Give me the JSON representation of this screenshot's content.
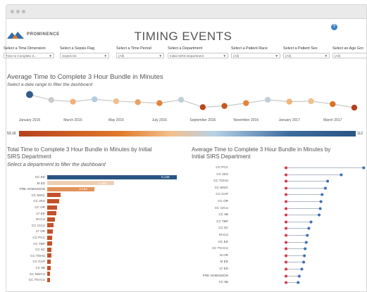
{
  "app": {
    "brand": "PROMINENCE",
    "title": "TIMING EVENTS"
  },
  "colors": {
    "accent_blue": "#2a5585",
    "accent_orange": "#b5411b",
    "help_blue": "#3d7fc6",
    "lollipop_red": "#d6374a"
  },
  "filters": [
    {
      "label": "Select a Time Dimension",
      "value": "Time to Complete 3..."
    },
    {
      "label": "Select a Sepsis Flag",
      "value": "Sepsis Dx"
    },
    {
      "label": "Select a Time Period",
      "value": "(All)"
    },
    {
      "label": "Select a Department",
      "value": "Initial SIRS Department"
    },
    {
      "label": "Select a Patient Race",
      "value": "(All)"
    },
    {
      "label": "Select a Patient Sex",
      "value": "(All)"
    },
    {
      "label": "Select an Age Gro",
      "value": "(All)"
    }
  ],
  "top_chart": {
    "title": "Average Time to Complete 3 Hour Bundle in Minutes",
    "subtitle": "Select a date range to filter the dashboard",
    "x_ticks": [
      "January 2016",
      "March 2016",
      "May 2016",
      "July 2016",
      "September 2016",
      "November 2016",
      "January 2017",
      "March 2017"
    ]
  },
  "legend": {
    "min_label": "53.16",
    "max_label": "112"
  },
  "left_chart": {
    "title_line1": "Total Time to Complete 3 Hour Bundle in Minutes by Initial",
    "title_line2": "SIRS Department",
    "subtitle": "Select a department to filter the dashboard"
  },
  "right_chart": {
    "title_line1": "Average Time to Complete 3 Hour Bundle in Minutes by",
    "title_line2": "Initial SIRS Department"
  },
  "chart_data": [
    {
      "type": "line",
      "x": [
        "2016-01",
        "2016-02",
        "2016-03",
        "2016-04",
        "2016-05",
        "2016-06",
        "2016-07",
        "2016-08",
        "2016-09",
        "2016-10",
        "2016-11",
        "2016-12",
        "2017-01",
        "2017-02",
        "2017-03",
        "2017-04"
      ],
      "values": [
        108,
        85,
        78,
        88,
        80,
        76,
        72,
        86,
        55,
        60,
        72,
        86,
        78,
        80,
        68,
        53
      ],
      "ylim": [
        50,
        115
      ]
    },
    {
      "type": "bar",
      "categories": [
        "CC ED",
        "M ED",
        "PRE ADMISSION",
        "CC MSIC",
        "CC 2KS",
        "CC OR",
        "17 ED",
        "M ICU",
        "CC CICU",
        "17 OR",
        "CC PCC",
        "CC TBP",
        "CC 6C",
        "CC TOHU",
        "CC GAP",
        "CC 5B",
        "CC NSICU",
        "CC TN ICU"
      ],
      "values": [
        6136,
        3162,
        2244,
        620,
        560,
        460,
        420,
        380,
        300,
        260,
        240,
        230,
        210,
        200,
        180,
        160,
        140,
        120
      ],
      "data_labels": [
        "6,136",
        "3,162",
        "2,244",
        "",
        "",
        "",
        "",
        "",
        "",
        "",
        "",
        "",
        "",
        "",
        "",
        "",
        "",
        ""
      ],
      "xlim": [
        0,
        6500
      ]
    },
    {
      "type": "scatter",
      "categories": [
        "CC PCC",
        "CC 2KS",
        "CC TOHU",
        "CC MSIC",
        "CC GAP",
        "CC OR",
        "CC CICU",
        "CC 5B",
        "CC TBP",
        "CC 6C",
        "M ICU",
        "CC ED",
        "CC TN ICU",
        "M OR",
        "M ED",
        "17 ED",
        "PRE ADMISSION",
        "CC 5B"
      ],
      "values": [
        211,
        150,
        113,
        107,
        98,
        95,
        93,
        90,
        68,
        62,
        58,
        55,
        52,
        50,
        48,
        43,
        36,
        33
      ],
      "baseline": 0,
      "xlim": [
        0,
        220
      ]
    }
  ]
}
